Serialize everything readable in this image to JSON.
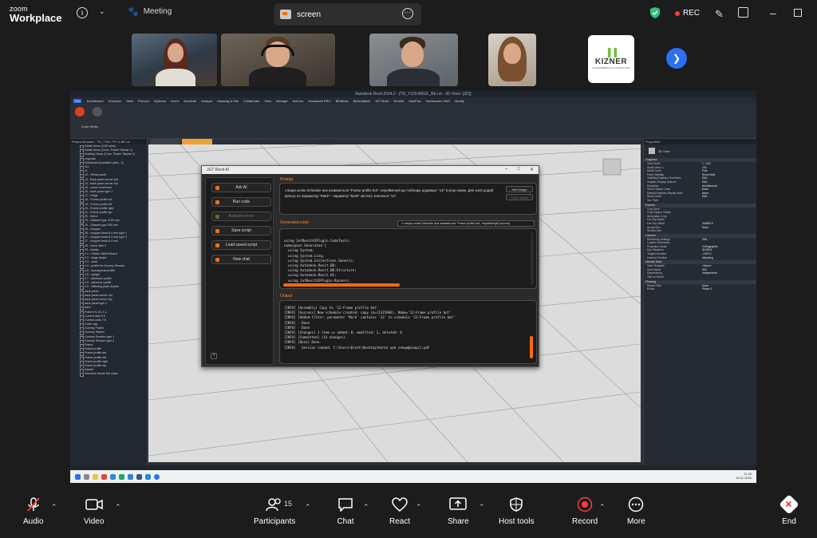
{
  "app": {
    "logo_top": "zoom",
    "logo_bottom": "Workplace",
    "meeting_label": "Meeting",
    "screen_label": "screen",
    "rec_label": "REC"
  },
  "colors": {
    "accent": "#ff6a00",
    "zoom_blue": "#2d6ff0",
    "rec_red": "#ff3b3b",
    "shield_green": "#2ec27e"
  },
  "participants": {
    "logo_tile_text": "KIZNER",
    "logo_tile_sub": "AI ENGINEERING & CONSULTING"
  },
  "revit": {
    "title": "Autodesk Revit 2024.2 - [TD_Y100-BR1E_BE.rvt - 3D View: {3D}]",
    "menu": [
      "File",
      "Architecture",
      "Structure",
      "Steel",
      "Precast",
      "Systems",
      "Insert",
      "Annotate",
      "Analyze",
      "Massing & Site",
      "Collaborate",
      "View",
      "Manage",
      "Add-Ins",
      "Naviswork PRO",
      "BIMBoss",
      "BIMcollabAI",
      "JGT Build",
      "RevitAI",
      "ModPlus",
      "Navisworks HNS",
      "Modify"
    ],
    "ribbon_label": "Code Writer",
    "project_browser_title": "Project Browser - TD_Y100- PF-D-BE.rvt",
    "tree": [
      "Detail Views (CSD view)",
      "Detail Views (Conn. Frame Tabular 1)",
      "Drafting Views (Conn. Frame Tabular 1)",
      "Legends",
      "Schedules/Quantities (Abo., 1)",
      "111",
      "11",
      "12 - Yellow panel",
      "13 - back panel corner bot",
      "14 - back panel corner top",
      "15 - corner connector",
      "16 - back panel type 1",
      "17 - Hinge",
      "18 - Frame profile bot",
      "19 - Frame profile left",
      "20 - Frame profile right",
      "21 - Frame profile top",
      "22 - Mirror",
      "23 - Glasses type 1100 mm",
      "24 - Glasses type 900 mm",
      "25 - chopper",
      "26 - chopper bead 6.4 mm type 1",
      "27 - chopper bead 6.4 mm type 2",
      "27 - chopper bead 6.4 mm",
      "28 - mirror filler 2",
      "29 - Isolate",
      "2.1 - Hidden Tablet Board",
      "2.2 - hinge board",
      "2.3 - cleat",
      "2.4 - profile for Gummy Session",
      "2.5 - downspouts profile",
      "2.6 - upright",
      "2.7 - Adhesive profile",
      "2.8 - adhesive profile",
      "2.9 - Wiltering plate double",
      "back panel",
      "back panel corner bot",
      "back panel corner top",
      "back panel type 1",
      "back",
      "Frame 91-16, 1.1",
      "Current ams 9.9",
      "Current units 7.8",
      "Cover cap",
      "Gummy Frame",
      "Gummy Station",
      "Gummy Session type 1",
      "Gummy Session type 2",
      "Frame",
      "Frame profile",
      "Frame profile bot",
      "Frame profile left",
      "Frame profile right",
      "Frame profile top",
      "Gasket",
      "Schedule Model Set value"
    ],
    "tab1": "3D01",
    "tab2": "3D - 3D (TDI)",
    "properties_title": "Properties",
    "view_type": "3D View",
    "properties": [
      {
        "section": "Graphics",
        "rows": [
          [
            "View Scale",
            "1 : 100"
          ],
          [
            "Scale Value 1:",
            "100"
          ],
          [
            "Detail Level",
            "Fine"
          ],
          [
            "Parts Visibility",
            "Show Both"
          ],
          [
            "Visibility/Graphics Overrides",
            "Edit..."
          ],
          [
            "Graphic Display Options",
            "Edit..."
          ],
          [
            "Discipline",
            "Architectural"
          ],
          [
            "Show Hidden Lines",
            "None"
          ],
          [
            "Default Analysis Display Style",
            "None"
          ],
          [
            "Show Grids",
            "Edit..."
          ],
          [
            "Sun Path",
            ""
          ]
        ]
      },
      {
        "section": "Extents",
        "rows": [
          [
            "Crop View",
            ""
          ],
          [
            "Crop Region Visible",
            ""
          ],
          [
            "Annotation Crop",
            ""
          ],
          [
            "Far Clip Active",
            ""
          ],
          [
            "Far Clip Offset",
            "304800.0"
          ],
          [
            "Scope Box",
            "None"
          ],
          [
            "Section Box",
            ""
          ]
        ]
      },
      {
        "section": "Camera",
        "rows": [
          [
            "Rendering Settings",
            "Edit..."
          ],
          [
            "Locked Orientation",
            ""
          ],
          [
            "Projection Mode",
            "Orthographic"
          ],
          [
            "Eye Elevation",
            "31035.8"
          ],
          [
            "Target Elevation",
            "-2400.0"
          ],
          [
            "Camera Position",
            "Adjusting"
          ]
        ]
      },
      {
        "section": "Identity Data",
        "rows": [
          [
            "View Template",
            "<None>"
          ],
          [
            "View Name",
            "3D1"
          ],
          [
            "Dependency",
            "Independent"
          ],
          [
            "Title on Sheet",
            ""
          ]
        ]
      },
      {
        "section": "Phasing",
        "rows": [
          [
            "Phase Filter",
            "None"
          ],
          [
            "Phase",
            "Phase 1"
          ]
        ]
      }
    ],
    "taskbar_time": "11:46",
    "taskbar_date": "16.01.2026"
  },
  "ai_window": {
    "title": "JGT Revit AI",
    "buttons": [
      "Ask AI",
      "Run code",
      "Analyze errors",
      "Save script",
      "Load saved script",
      "New chat"
    ],
    "prompt_label": "Prompt",
    "prompt_text": "створи копію Schedule яка називається \"Frame profile bot\", перейменуй цю таблицю додавши \"-12\" в кінці назви. Для копії додай фільтр по параметру \"Mark\" - параметр \"Mark\" містить значення \"12\".",
    "add_image": "Add image",
    "clear_image": "Clear image",
    "generated_label": "Generated code",
    "code_select": "1 створи копію Schedule яка називається \"Frame profile bot\", перейменуй (current)",
    "code": "using JetRevitAIPlugin.CodeTools;\nnamespace Generated {\n  using System;\n  using System.Linq;\n  using System.Collections.Generic;\n  using Autodesk.Revit.DB;\n  using Autodesk.Revit.DB.Structure;\n  using Autodesk.Revit.UI;\n  using JetRevitAIPlugin.Runners;",
    "output_label": "Output",
    "output": "[INFO] [Assembly] Copy to '12-Frame profile bot'\n[INFO] [Success] New schedule created: copy id=(1321984), Name='12-Frame profile bot'\n[INFO] [Added filter: parameter 'Mark' contains '12' to schedule '12-Frame profile bot'\n[INFO] - Done\n[INFO] - Done\n[INFO] [Changes] 1 item => added: 0, modified: 2, deleted: 0\n[INFO] [Committed] (14 changes).\n[INFO] [Done] Done.\n[INFO]   Session loaded: C:\\Users\\Brett\\Desktop\\Копія для специфікації.pdf"
  },
  "toolbar": {
    "audio": "Audio",
    "video": "Video",
    "participants": "Participants",
    "participants_count": "15",
    "chat": "Chat",
    "react": "React",
    "share": "Share",
    "host_tools": "Host tools",
    "record": "Record",
    "more": "More",
    "end": "End"
  }
}
